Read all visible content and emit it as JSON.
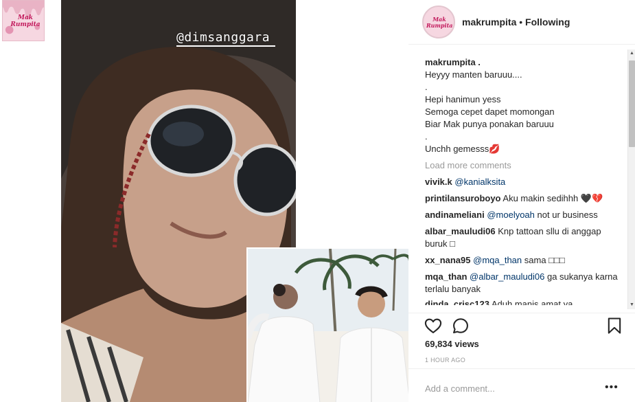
{
  "corner_logo": {
    "text_top": "Mak",
    "text_bottom": "Rumpita"
  },
  "media": {
    "sticker_mention": "@dimsanggara"
  },
  "header": {
    "username": "makrumpita",
    "separator": " • ",
    "follow_status": "Following"
  },
  "caption": {
    "username": "makrumpita .",
    "lines": [
      "Heyyy manten baruuu....",
      ".",
      "Hepi hanimun yess",
      "Semoga cepet dapet momongan",
      "Biar Mak punya ponakan baruuu",
      ".",
      "Unchh gemesss💋"
    ]
  },
  "load_more": "Load more comments",
  "comments": [
    {
      "user": "vivik.k",
      "mention": "@kanialksita",
      "text": ""
    },
    {
      "user": "printilansuroboyo",
      "mention": "",
      "text": "Aku makin sedihhh 🖤💔"
    },
    {
      "user": "andinameliani",
      "mention": "@moelyoah",
      "text": "not ur business"
    },
    {
      "user": "albar_mauludi06",
      "mention": "",
      "text": "Knp tattoan sllu di anggap buruk □"
    },
    {
      "user": "xx_nana95",
      "mention": "@mqa_than",
      "text": "sama □□□"
    },
    {
      "user": "mqa_than",
      "mention": "@albar_mauludi06",
      "text": "ga sukanya karna terlalu banyak"
    },
    {
      "user": "dinda_crisc123",
      "mention": "",
      "text": "Aduh manis amat ya"
    }
  ],
  "actions": {
    "like_icon": "heart-outline-icon",
    "comment_icon": "speech-bubble-icon",
    "save_icon": "bookmark-icon"
  },
  "views": "69,834 views",
  "timestamp": "1 HOUR AGO",
  "add_comment_placeholder": "Add a comment...",
  "more_label": "•••"
}
